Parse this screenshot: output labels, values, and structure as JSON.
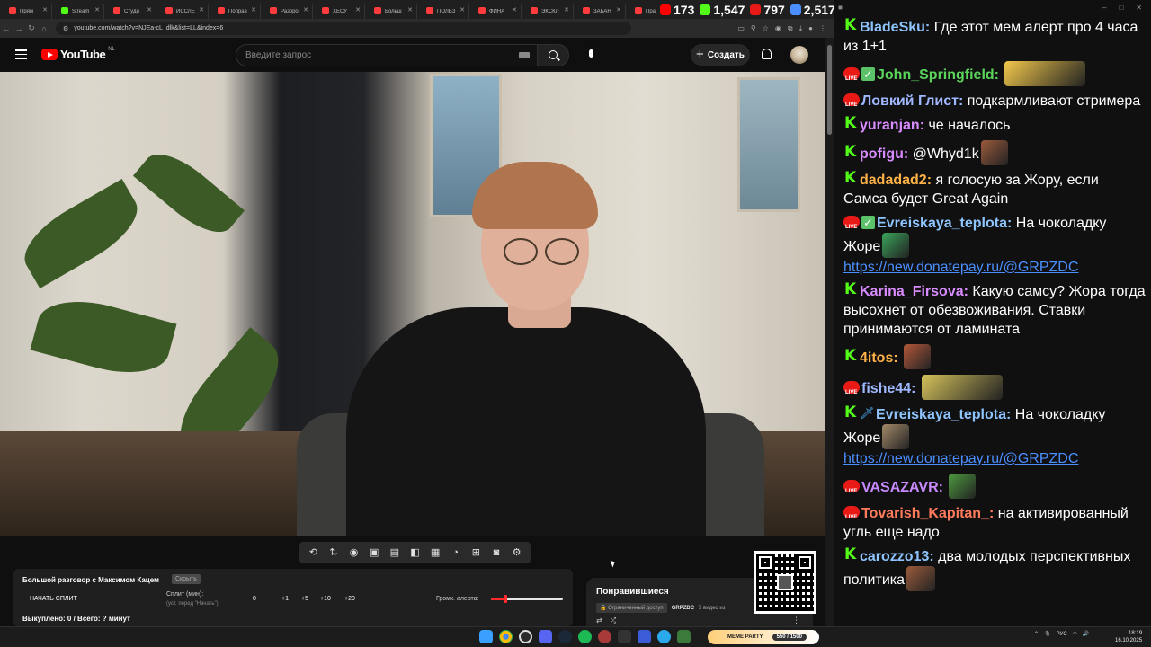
{
  "browser": {
    "tabs": [
      {
        "label": "Прям",
        "color": "#ff3b3b"
      },
      {
        "label": "Stream",
        "color": "#53fc18"
      },
      {
        "label": "Студи",
        "color": "#ff3b3b"
      },
      {
        "label": "ИССЛЕ",
        "color": "#ff3b3b"
      },
      {
        "label": "Поправ",
        "color": "#ff3b3b"
      },
      {
        "label": "Разоро",
        "color": "#ff3b3b"
      },
      {
        "label": "ХЕСУ",
        "color": "#ff3b3b"
      },
      {
        "label": "Больш",
        "color": "#ff3b3b"
      },
      {
        "label": "ПОЛЬЗ",
        "color": "#ff3b3b"
      },
      {
        "label": "ФИНА",
        "color": "#ff3b3b"
      },
      {
        "label": "ЭКСКЛ",
        "color": "#ff3b3b"
      },
      {
        "label": "ЗАБАН",
        "color": "#ff3b3b"
      },
      {
        "label": "Пра",
        "color": "#ff3b3b"
      }
    ],
    "url": "youtube.com/watch?v=NJEa-cL_dlk&list=LL&index=6"
  },
  "stream_stats": {
    "youtube": "173",
    "kick": "1,547",
    "vk": "797",
    "total": "2,517"
  },
  "youtube": {
    "logo": "YouTube",
    "region": "NL",
    "search_placeholder": "Введите запрос",
    "create_label": "Создать"
  },
  "split": {
    "title": "Большой разговор с Максимом Кацем",
    "hide_label": "Скрыть",
    "start_label": "НАЧАТЬ СПЛИТ",
    "split_label": "Сплит (мин):",
    "split_hint": "(уст. перед \"Начать\")",
    "value": "0",
    "increments": [
      "+1",
      "+5",
      "+10",
      "+20"
    ],
    "volume_label": "Громк. алерта:",
    "volume_fraction": 0.2,
    "summary": "Выкуплено: 0 / Всего: ? минут"
  },
  "playlist": {
    "title": "Понравившиеся",
    "access": "Ограниченный доступ",
    "owner": "GRPZDC",
    "count": "5 видео из"
  },
  "chat": {
    "messages": [
      {
        "badges": [
          "k"
        ],
        "user": "BladeSku",
        "color": "#8ec5ff",
        "text": "Где этот мем алерт про 4 часа из 1+1"
      },
      {
        "badges": [
          "live",
          "check"
        ],
        "user": "John_Springfield",
        "color": "#5bd45b",
        "text": "",
        "emotes": [
          "#f2c84b"
        ],
        "emote_width": 90
      },
      {
        "badges": [
          "live"
        ],
        "user": "Ловкий Глист",
        "color": "#9fb8ff",
        "text": "подкармливают стримера"
      },
      {
        "badges": [
          "k"
        ],
        "user": "yuranjan",
        "color": "#d98cff",
        "text": "че началось"
      },
      {
        "badges": [
          "k"
        ],
        "user": "pofigu",
        "color": "#d98cff",
        "text": "@Whyd1k",
        "emotes": [
          "#9b5a3c"
        ],
        "emote_width": 30
      },
      {
        "badges": [
          "k"
        ],
        "user": "dadadad2",
        "color": "#ffb347",
        "text": "я голосую за Жору, если Самса будет Great Again"
      },
      {
        "badges": [
          "live",
          "check"
        ],
        "user": "Evreiskaya_teplota",
        "color": "#8ec5ff",
        "text": "На чоколадку Жоре",
        "emotes": [
          "#3aa35a"
        ],
        "emote_width": 30,
        "link": "https://new.donatepay.ru/@GRPZDC"
      },
      {
        "badges": [
          "k"
        ],
        "user": "Karina_Firsova",
        "color": "#d98cff",
        "text": "Какую самсу? Жора тогда высохнет от обезвоживания. Ставки принимаются от ламината"
      },
      {
        "badges": [
          "k"
        ],
        "user": "4itos",
        "color": "#ffb347",
        "text": "",
        "emotes": [
          "#b4583a"
        ],
        "emote_width": 30
      },
      {
        "badges": [
          "live"
        ],
        "user": "fishe44",
        "color": "#9fb8ff",
        "text": "",
        "emotes": [
          "#d4c25b"
        ],
        "emote_width": 90
      },
      {
        "badges": [
          "k",
          "sword"
        ],
        "user": "Evreiskaya_teplota",
        "color": "#8ec5ff",
        "text": "На чоколадку Жоре",
        "emotes": [
          "#a38a6a"
        ],
        "emote_width": 30,
        "link": "https://new.donatepay.ru/@GRPZDC"
      },
      {
        "badges": [
          "live"
        ],
        "user": "VASAZAVR",
        "color": "#c98aff",
        "text": "",
        "emotes": [
          "#4e9a3f"
        ],
        "emote_width": 30
      },
      {
        "badges": [
          "live"
        ],
        "user": "Tovarish_Kapitan_",
        "color": "#ff7b5c",
        "text": "на активированный угль еще надо"
      },
      {
        "badges": [
          "k"
        ],
        "user": "carozzo13",
        "color": "#8ec5ff",
        "text": "два молодых перспективных политика",
        "emotes": [
          "#9b5a3c"
        ],
        "emote_width": 32
      }
    ]
  },
  "taskbar": {
    "meme_party": "MEME PARTY",
    "meme_count": "550 / 1500",
    "lang": "РУС",
    "time": "18:19",
    "date": "16.10.2025"
  }
}
